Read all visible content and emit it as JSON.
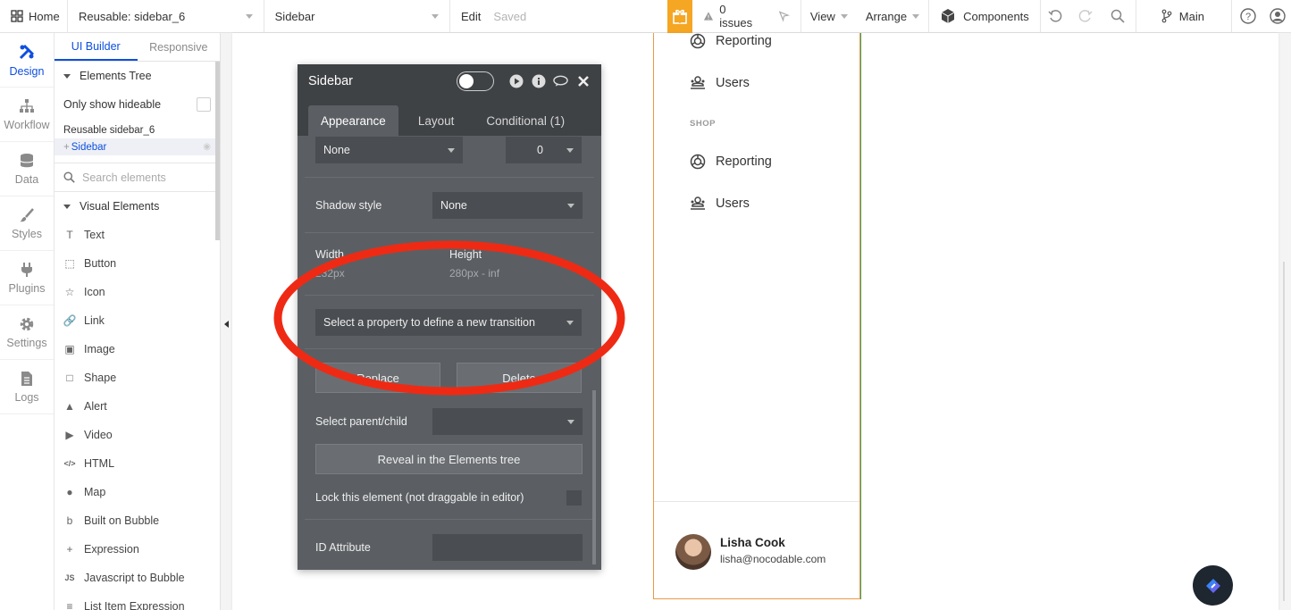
{
  "topbar": {
    "home_label": "Home",
    "page_selector": "Reusable: sidebar_6",
    "element_selector": "Sidebar",
    "edit_label": "Edit",
    "saved_label": "Saved",
    "issues_label": "0 issues",
    "view_label": "View",
    "arrange_label": "Arrange",
    "components_label": "Components",
    "branch_label": "Main",
    "accent_color": "#f5a623"
  },
  "leftnav": {
    "items": [
      {
        "label": "Design",
        "icon": "design-icon"
      },
      {
        "label": "Workflow",
        "icon": "workflow-icon"
      },
      {
        "label": "Data",
        "icon": "data-icon"
      },
      {
        "label": "Styles",
        "icon": "brush-icon"
      },
      {
        "label": "Plugins",
        "icon": "plug-icon"
      },
      {
        "label": "Settings",
        "icon": "gear-icon"
      },
      {
        "label": "Logs",
        "icon": "document-icon"
      }
    ],
    "active_color": "#0d4fe0"
  },
  "elements_panel": {
    "tabs": [
      "UI Builder",
      "Responsive"
    ],
    "tree_label": "Elements Tree",
    "only_hideable_label": "Only show hideable",
    "root_label": "Reusable sidebar_6",
    "selected_label": "Sidebar",
    "search_placeholder": "Search elements",
    "visual_elements_label": "Visual Elements",
    "visual_elements": [
      {
        "label": "Text",
        "icon": "text-icon"
      },
      {
        "label": "Button",
        "icon": "button-icon"
      },
      {
        "label": "Icon",
        "icon": "star-icon"
      },
      {
        "label": "Link",
        "icon": "link-icon"
      },
      {
        "label": "Image",
        "icon": "image-icon"
      },
      {
        "label": "Shape",
        "icon": "shape-icon"
      },
      {
        "label": "Alert",
        "icon": "alert-icon"
      },
      {
        "label": "Video",
        "icon": "video-icon"
      },
      {
        "label": "HTML",
        "icon": "code-icon"
      },
      {
        "label": "Map",
        "icon": "map-pin-icon"
      },
      {
        "label": "Built on Bubble",
        "icon": "bubble-icon"
      },
      {
        "label": "Expression",
        "icon": "plus-icon"
      },
      {
        "label": "Javascript to Bubble",
        "icon": "js-icon"
      },
      {
        "label": "List Item Expression",
        "icon": "list-icon"
      }
    ]
  },
  "property_editor": {
    "title": "Sidebar",
    "tabs": [
      "Appearance",
      "Layout",
      "Conditional (1)"
    ],
    "border_style_value": "None",
    "border_width_value": "0",
    "shadow_style_label": "Shadow style",
    "shadow_style_value": "None",
    "width_label": "Width",
    "width_value": "232px",
    "height_label": "Height",
    "height_value": "280px - inf",
    "transition_placeholder": "Select a property to define a new transition",
    "replace_label": "Replace",
    "delete_label": "Delete",
    "parent_child_label": "Select parent/child",
    "reveal_label": "Reveal in the Elements tree",
    "lock_label": "Lock this element (not draggable in editor)",
    "id_attribute_label": "ID Attribute",
    "annotation_color": "#ef2a14"
  },
  "sidebar_preview": {
    "top_items": [
      {
        "label": "Reporting",
        "icon": "reporting-icon"
      },
      {
        "label": "Users",
        "icon": "users-icon"
      }
    ],
    "section_label": "SHOP",
    "shop_items": [
      {
        "label": "Reporting",
        "icon": "reporting-icon"
      },
      {
        "label": "Users",
        "icon": "users-icon"
      }
    ],
    "user": {
      "name": "Lisha Cook",
      "email": "lisha@nocodable.com"
    },
    "border_color": "#e89a46"
  }
}
